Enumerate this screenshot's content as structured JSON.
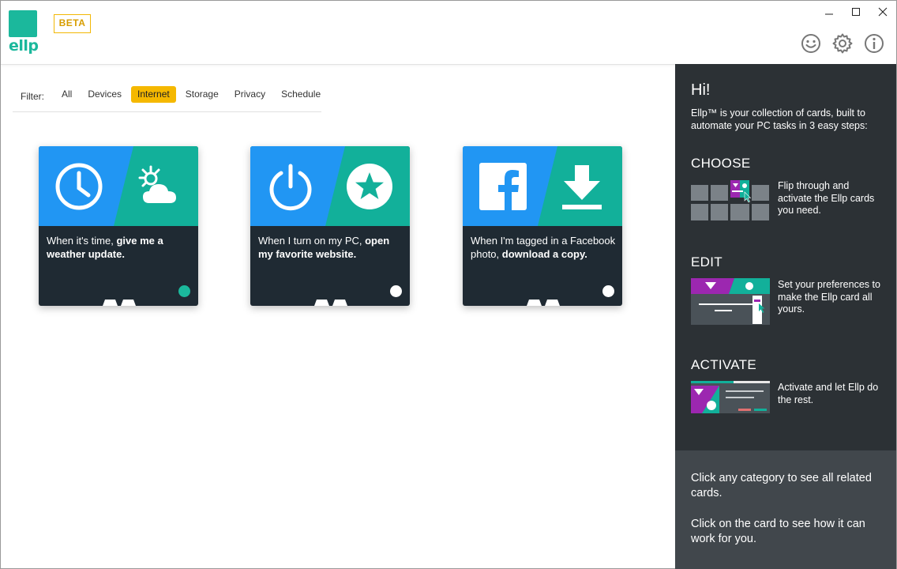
{
  "app": {
    "logo_text": "ellp",
    "beta": "BETA"
  },
  "filter": {
    "label": "Filter:",
    "items": [
      "All",
      "Devices",
      "Internet",
      "Storage",
      "Privacy",
      "Schedule"
    ],
    "active": "Internet"
  },
  "cards": [
    {
      "text_plain": "When it's time, ",
      "text_bold": "give me a weather update.",
      "left_color": "#2196f3",
      "right_color": "#12b09a",
      "left_icon": "clock-icon",
      "right_icon": "weather-icon",
      "dot": "teal"
    },
    {
      "text_plain": "When I turn on my PC, ",
      "text_bold": "open my favorite website.",
      "left_color": "#2196f3",
      "right_color": "#12b09a",
      "left_icon": "power-icon",
      "right_icon": "star-icon",
      "dot": "white"
    },
    {
      "text_plain": "When I'm tagged in a Facebook photo, ",
      "text_bold": "download a copy.",
      "left_color": "#2196f3",
      "right_color": "#12b09a",
      "left_icon": "facebook-icon",
      "right_icon": "download-icon",
      "dot": "white"
    }
  ],
  "panel": {
    "hi": "Hi!",
    "intro": "Ellp™ is your collection of cards, built to automate your PC tasks in 3 easy steps:",
    "steps": [
      {
        "title": "CHOOSE",
        "desc": "Flip through and activate the Ellp cards you need."
      },
      {
        "title": "EDIT",
        "desc": "Set your preferences to make the Ellp card all yours."
      },
      {
        "title": "ACTIVATE",
        "desc": "Activate and let Ellp do the rest."
      }
    ],
    "bottom": [
      "Click any category to see all related cards.",
      "Click on the card to see how it can work for you."
    ]
  },
  "colors": {
    "brand": "#1bb89c",
    "accent": "#f5b800",
    "panel_dark": "#2c3135",
    "panel_bottom": "#41474c",
    "card_dark": "#1f2a33",
    "purple": "#9c27b0"
  }
}
